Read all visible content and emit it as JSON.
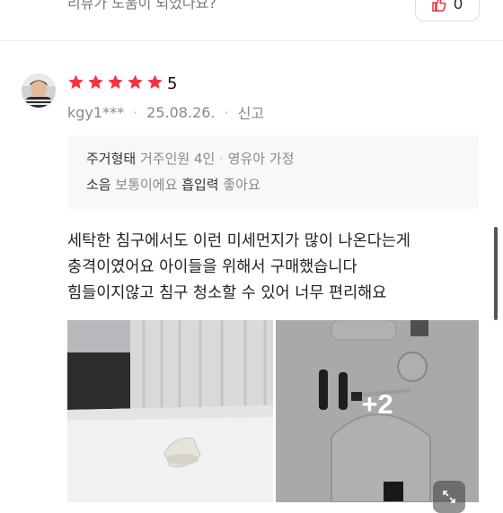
{
  "previous_review": {
    "helpful_question": "리뷰가 도움이 되었나요?",
    "helpful_count": "0"
  },
  "review": {
    "rating": "5",
    "stars": 5,
    "user_id": "kgy1***",
    "date": "25.08.26.",
    "report_label": "신고",
    "info": {
      "row1": [
        {
          "label": "주거형태",
          "value": "거주인원 4인"
        },
        {
          "label": "",
          "value": "영유아 가정"
        }
      ],
      "row2": [
        {
          "label": "소음",
          "value": "보통이에요"
        },
        {
          "label": "흡입력",
          "value": "좋아요"
        }
      ]
    },
    "text_lines": [
      "세탁한 침구에서도 이런 미세먼지가 많이 나온다는게",
      "충격이였어요 아이들을 위해서 구매했습니다",
      "힘들이지않고 침구 청소할 수 있어 너무 편리해요"
    ],
    "more_photos": "+2"
  },
  "colors": {
    "star": "#f5333f",
    "helpful_icon": "#e8303a"
  }
}
